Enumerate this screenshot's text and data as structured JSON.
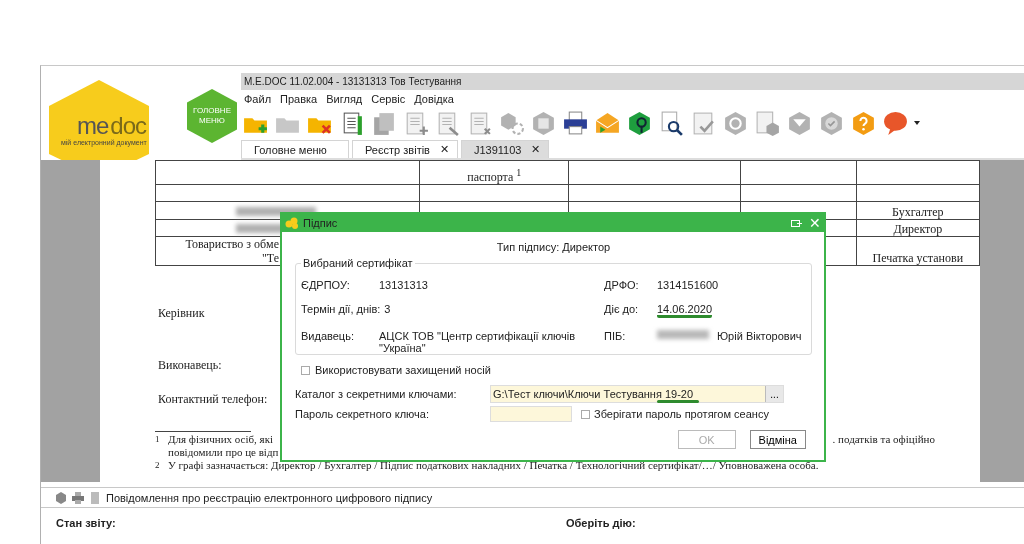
{
  "window": {
    "title": "M.E.DOC 11.02.004  - 13131313 Тов Тестування"
  },
  "logo": {
    "brand_first": "me",
    "brand_second": "doc",
    "tagline": "мій електронний документ"
  },
  "main_menu_button": {
    "label": "ГОЛОВНЕ МЕНЮ"
  },
  "menu": [
    "Файл",
    "Правка",
    "Вигляд",
    "Сервіс",
    "Довідка"
  ],
  "toolbar": [
    {
      "disabled": false
    },
    {
      "disabled": true
    },
    {
      "disabled": false
    },
    {
      "disabled": false
    },
    {
      "disabled": true
    },
    {
      "disabled": true
    },
    {
      "disabled": true
    },
    {
      "disabled": true
    },
    {
      "disabled": true
    },
    {
      "disabled": true
    },
    {
      "disabled": false
    },
    {
      "disabled": false
    },
    {
      "disabled": false
    },
    {
      "disabled": false
    },
    {
      "disabled": true
    },
    {
      "disabled": true
    },
    {
      "disabled": true
    },
    {
      "disabled": true
    },
    {
      "disabled": true
    },
    {
      "disabled": false
    },
    {
      "disabled": false
    }
  ],
  "tabs": [
    {
      "label": "Головне меню",
      "selected": false
    },
    {
      "label": "Реєстр звітів",
      "close": "✕",
      "selected": false
    },
    {
      "label": "J1391103",
      "close": "✕",
      "selected": true
    }
  ],
  "document": {
    "table_rows": [
      {
        "cells": [
          "",
          "паспорта $^{1}$",
          "",
          "",
          ""
        ]
      },
      {
        "cells": [
          "",
          "",
          "",
          "",
          ""
        ]
      },
      {
        "redacted": true,
        "cells": [
          "",
          "",
          "",
          "",
          "Бухгалтер"
        ]
      },
      {
        "redacted": true,
        "cells": [
          "",
          "",
          "",
          "",
          "Директор"
        ]
      },
      {
        "cells": [
          "Товариство з обме\n\"Те",
          "",
          "",
          "",
          "Печатка установи"
        ]
      }
    ],
    "signatures": [
      "Керівник",
      "Виконавець:",
      "Контактний телефон:"
    ],
    "footnote_1": {
      "mark": "1",
      "left": "Для фізичних осіб, які",
      "right": ". податків та офіційно",
      "second_line": "повідомили про це відп"
    },
    "footnote_2": {
      "mark": "2",
      "text": "У графі зазначається: Директор / Бухгалтер / Підпис податкових накладних / Печатка / Технологічний сертифікат/…/ Уповноважена особа."
    }
  },
  "bottom_panel": {
    "title": "Повідомлення про реєстрацію електронного цифрового підпису",
    "left_heading": "Стан звіту:",
    "right_heading": "Оберіть дію:"
  },
  "dialog": {
    "title": "Підпис",
    "close": "✕",
    "signature_type": "Тип підпису: Директор",
    "certificate": {
      "legend": "Вибраний сертифікат",
      "fields": [
        {
          "label": "ЄДРПОУ:",
          "value": "13131313"
        },
        {
          "label": "ДРФО:",
          "value": "1314151600"
        },
        {
          "label": "Термін дії, днів:",
          "value": "3"
        },
        {
          "label": "Діє до:",
          "value": "14.06.2020",
          "highlighted": true
        },
        {
          "label": "Видавець:",
          "value": "АЦСК ТОВ \"Центр сертифікації ключів \"Україна\""
        },
        {
          "label": "ПІБ:",
          "value": "Юрій Вікторович",
          "redacted": true
        }
      ]
    },
    "secure_media": {
      "label": "Використовувати захищений носій",
      "checked": false
    },
    "key_dir": {
      "label": "Каталог з секретними ключами:",
      "value": "G:\\Тест ключи\\Ключи Тестування 19-20",
      "highlighted": true,
      "browse": "..."
    },
    "password": {
      "label": "Пароль секретного ключа:"
    },
    "remember": {
      "label": "Зберігати пароль протягом сеансу",
      "checked": false
    },
    "buttons": [
      {
        "label": "OK",
        "disabled": true
      },
      {
        "label": "Відміна",
        "disabled": false
      }
    ]
  }
}
